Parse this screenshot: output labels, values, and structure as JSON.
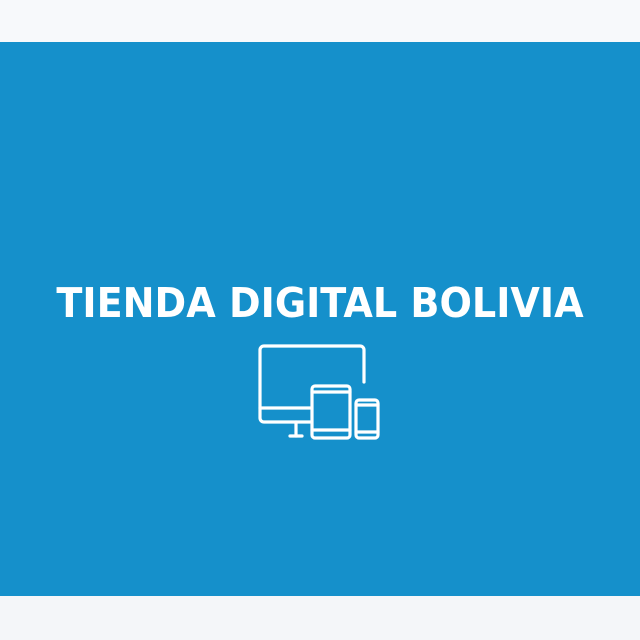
{
  "brand": {
    "title": "TIENDA DIGITAL BOLIVIA",
    "icon": "devices-icon",
    "background_color": "#1590cb",
    "text_color": "#ffffff"
  }
}
